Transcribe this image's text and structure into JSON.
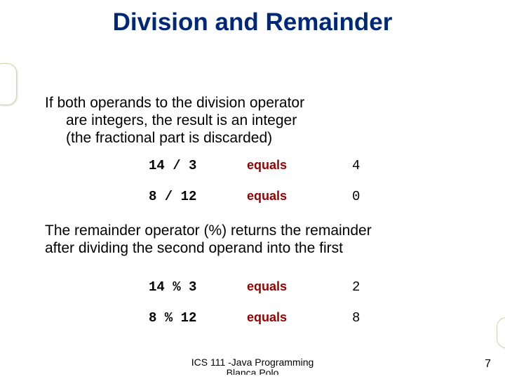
{
  "title": "Division and Remainder",
  "para1": {
    "line1": "If both operands to the division operator",
    "line2": "are integers, the result is an integer",
    "line3": "(the fractional part is discarded)"
  },
  "division_rows": [
    {
      "expr": "14 / 3",
      "eq": "equals",
      "res": "4"
    },
    {
      "expr": "8 / 12",
      "eq": "equals",
      "res": "0"
    }
  ],
  "para2": {
    "line1": "The remainder operator (%) returns the remainder",
    "line2": "after dividing the second operand into the first"
  },
  "remainder_rows": [
    {
      "expr": "14 % 3",
      "eq": "equals",
      "res": "2"
    },
    {
      "expr": "8 % 12",
      "eq": "equals",
      "res": "8"
    }
  ],
  "footer": {
    "line1": "ICS 111 -Java Programming",
    "line2": "Blanca Polo"
  },
  "page_number": "7"
}
